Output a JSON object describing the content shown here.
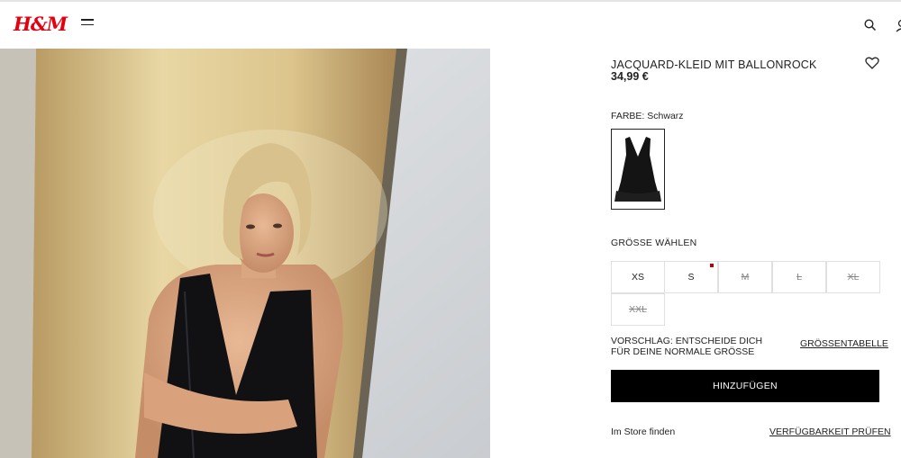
{
  "brand": {
    "logo_text": "H&M",
    "logo_color": "#e50010"
  },
  "header": {
    "menu_icon": "hamburger-icon",
    "search_icon": "search-icon",
    "account_icon": "user-icon"
  },
  "product": {
    "title": "JACQUARD-KLEID MIT BALLONROCK",
    "price": "34,99 €",
    "wishlist_icon": "heart-icon",
    "color_label": "FARBE: Schwarz",
    "size_label": "GRÖSSE WÄHLEN",
    "sizes": [
      {
        "label": "XS",
        "available": true,
        "low_stock": false
      },
      {
        "label": "S",
        "available": true,
        "low_stock": true
      },
      {
        "label": "M",
        "available": false,
        "low_stock": false
      },
      {
        "label": "L",
        "available": false,
        "low_stock": false
      },
      {
        "label": "XL",
        "available": false,
        "low_stock": false
      },
      {
        "label": "XXL",
        "available": false,
        "low_stock": false
      }
    ],
    "size_hint": "VORSCHLAG: ENTSCHEIDE DICH FÜR DEINE NORMALE GRÖSSE",
    "size_chart_link": "GRÖSSENTABELLE",
    "add_button": "HINZUFÜGEN",
    "store_label": "Im Store finden",
    "availability_link": "VERFÜGBARKEIT PRÜFEN"
  },
  "colors": {
    "primary_button": "#000000",
    "low_stock_indicator": "#c00000"
  }
}
